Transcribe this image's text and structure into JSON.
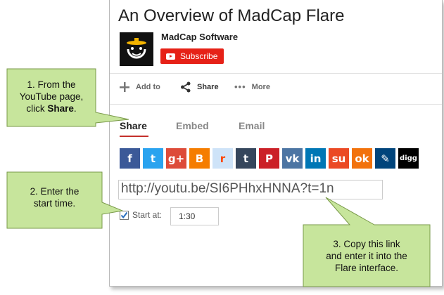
{
  "video": {
    "title": "An Overview of MadCap Flare"
  },
  "channel": {
    "name": "MadCap Software",
    "subscribe_label": "Subscribe"
  },
  "actions": {
    "add_to": "Add to",
    "share": "Share",
    "more": "More"
  },
  "tabs": {
    "share": "Share",
    "embed": "Embed",
    "email": "Email"
  },
  "share_icons": [
    {
      "name": "facebook-icon",
      "glyph": "f",
      "color": "#3b5998"
    },
    {
      "name": "twitter-icon",
      "glyph": "t",
      "color": "#2aa3ef"
    },
    {
      "name": "google-plus-icon",
      "glyph": "g+",
      "color": "#dd4b39"
    },
    {
      "name": "blogger-icon",
      "glyph": "B",
      "color": "#f57d00"
    },
    {
      "name": "reddit-icon",
      "glyph": "r",
      "color": "#cee3f8"
    },
    {
      "name": "tumblr-icon",
      "glyph": "t",
      "color": "#35465c"
    },
    {
      "name": "pinterest-icon",
      "glyph": "P",
      "color": "#cb2027"
    },
    {
      "name": "vk-icon",
      "glyph": "vk",
      "color": "#4c75a3"
    },
    {
      "name": "linkedin-icon",
      "glyph": "in",
      "color": "#0077b5"
    },
    {
      "name": "stumbleupon-icon",
      "glyph": "su",
      "color": "#eb4924"
    },
    {
      "name": "odnoklassniki-icon",
      "glyph": "ok",
      "color": "#f2720c"
    },
    {
      "name": "live-journal-icon",
      "glyph": "✎",
      "color": "#00447b"
    },
    {
      "name": "digg-icon",
      "glyph": "digg",
      "color": "#000000"
    }
  ],
  "share_link": {
    "url": "http://youtu.be/SI6PHhxHNNA?t=1n"
  },
  "start_at": {
    "label": "Start at:",
    "value": "1:30",
    "checked": true
  },
  "callouts": {
    "one": {
      "line1": "1. From the",
      "line2": "YouTube page,",
      "line3_prefix": "click ",
      "line3_bold": "Share",
      "line3_suffix": "."
    },
    "two": {
      "line1": "2. Enter the",
      "line2": "start time."
    },
    "three": {
      "line1": "3. Copy this link",
      "line2": "and enter it into the",
      "line3": "Flare interface."
    }
  },
  "colors": {
    "callout_fill": "#c7e59c",
    "callout_border": "#7a9a4a",
    "subscribe": "#e62117",
    "tab_accent": "#c4302b"
  }
}
